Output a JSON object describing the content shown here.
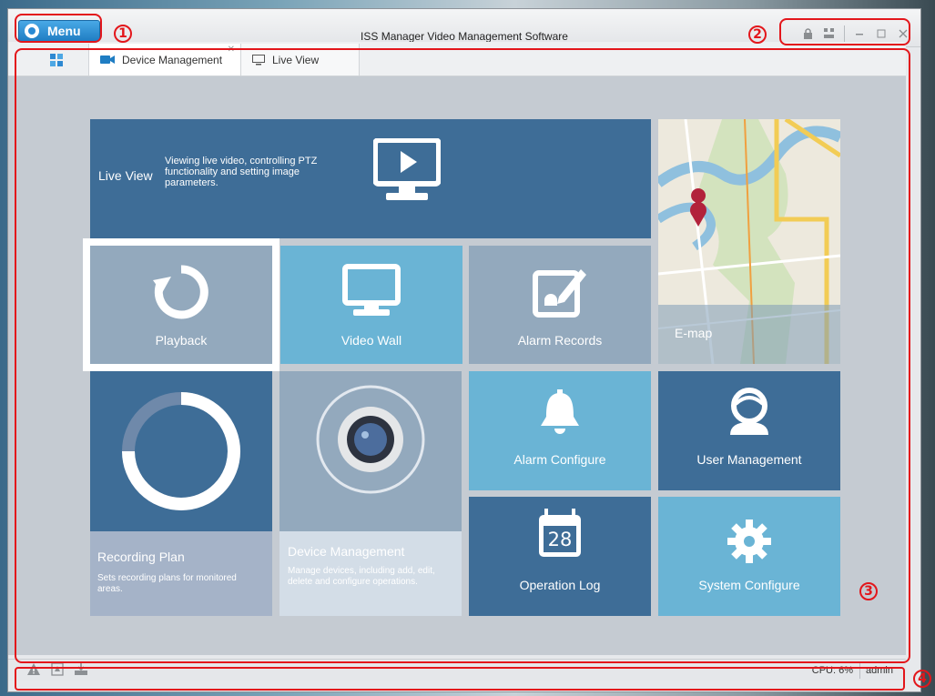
{
  "window": {
    "title": "ISS Manager Video Management Software",
    "menu_label": "Menu"
  },
  "annotations": [
    "1",
    "2",
    "3",
    "4"
  ],
  "tabs": [
    {
      "label": "",
      "icon": "dashboard-grid-icon"
    },
    {
      "label": "Device Management",
      "icon": "video-camera-icon"
    },
    {
      "label": "Live View",
      "icon": "monitor-icon"
    }
  ],
  "tiles": {
    "live_view": {
      "title": "Live View",
      "desc": "Viewing live video, controlling PTZ functionality and setting image parameters."
    },
    "playback": {
      "label": "Playback"
    },
    "video_wall": {
      "label": "Video Wall"
    },
    "alarm_records": {
      "label": "Alarm Records"
    },
    "emap": {
      "label": "E-map"
    },
    "recording_plan": {
      "title": "Recording Plan",
      "desc": "Sets recording plans for monitored areas."
    },
    "device_management": {
      "title": "Device Management",
      "desc": "Manage devices, including add, edit, delete and configure operations."
    },
    "alarm_configure": {
      "label": "Alarm Configure"
    },
    "user_management": {
      "label": "User Management"
    },
    "operation_log": {
      "label": "Operation Log",
      "calendar_day": "28"
    },
    "system_configure": {
      "label": "System Configure"
    }
  },
  "status": {
    "cpu": "CPU: 6%",
    "user": "admin"
  },
  "colors": {
    "accent_blue": "#1f7dc3",
    "tile_dark": "#3e6d97",
    "tile_light": "#6ab4d5",
    "tile_gray": "#93a9bd",
    "annotation_red": "#e3161b"
  }
}
